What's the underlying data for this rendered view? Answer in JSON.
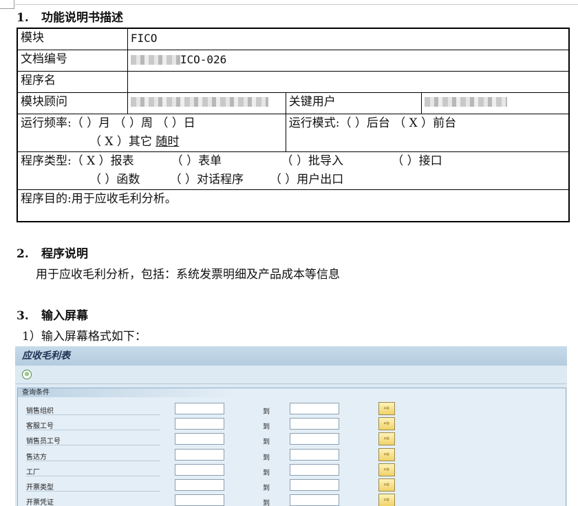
{
  "sections": [
    {
      "num": "1.",
      "title": "功能说明书描述"
    },
    {
      "num": "2.",
      "title": "程序说明"
    },
    {
      "num": "3.",
      "title": "输入屏幕"
    }
  ],
  "spec": {
    "module_label": "模块",
    "module_value": "FICO",
    "doc_label": "文档编号",
    "doc_value": "ICO-026",
    "program_label": "程序名",
    "consultant_label": "模块顾问",
    "key_user_label": "关键用户",
    "frequency_line1": "运行频率:（ ）月  （ ）周  （ ）日",
    "frequency_line2_prefix": "（ X ）其它 ",
    "frequency_other": "随时",
    "mode": "运行模式:（  ）后台 （ X ）前台",
    "type_line1": "程序类型:（ X ）报表          （ ）表单                （ ）批导入             （ ）接口",
    "type_line2": "（ ）函数        （ ）对话程序       （ ）用户出口",
    "purpose": "程序目的:用于应收毛利分析。"
  },
  "description": "用于应收毛利分析，包括：系统发票明细及产品成本等信息",
  "input_intro": "1）输入屏幕格式如下：",
  "sap": {
    "title": "应收毛利表",
    "exec_icon": "execute-icon",
    "group_title": "查询条件",
    "to_label": "到",
    "rows": [
      "销售组织",
      "客服工号",
      "销售员工号",
      "售达方",
      "工厂",
      "开票类型",
      "开票凭证"
    ]
  }
}
